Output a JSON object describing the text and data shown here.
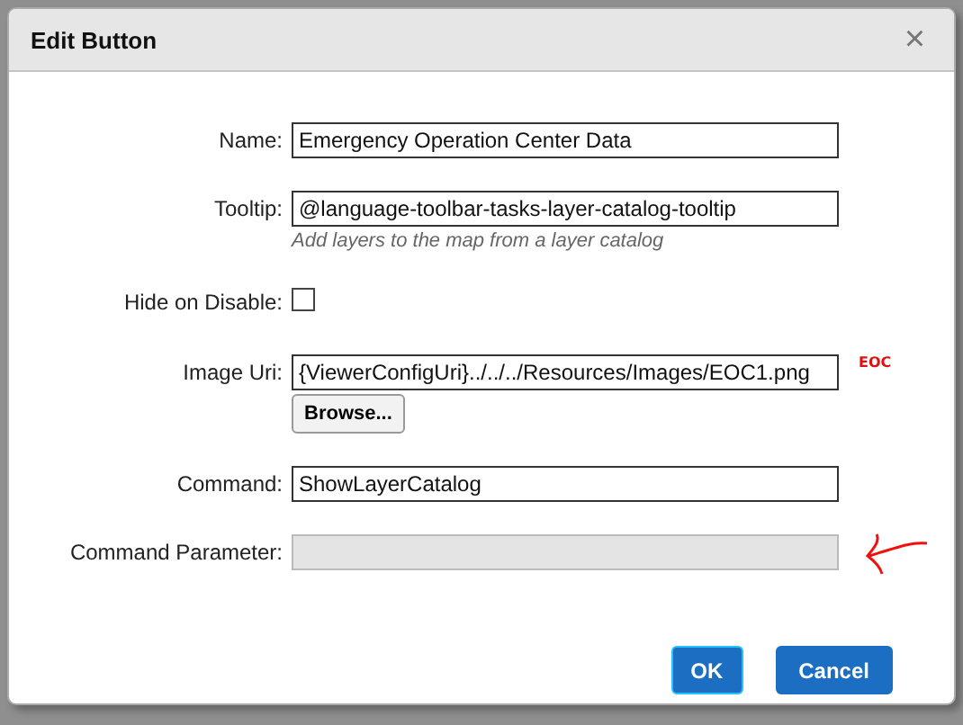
{
  "dialog": {
    "title": "Edit Button",
    "close": "×"
  },
  "fields": [
    {
      "kind": "text",
      "label": "Name:",
      "value": "Emergency Operation Center Data"
    },
    {
      "kind": "text",
      "label": "Tooltip:",
      "value": "@language-toolbar-tasks-layer-catalog-tooltip",
      "hint": "Add layers to the map from a layer catalog"
    },
    {
      "kind": "checkbox",
      "label": "Hide on Disable:",
      "checked": false
    },
    {
      "kind": "file",
      "label": "Image Uri:",
      "value": "{ViewerConfigUri}../../../Resources/Images/EOC1.png",
      "button": "Browse...",
      "note": "EOC"
    },
    {
      "kind": "text",
      "label": "Command:",
      "value": "ShowLayerCatalog"
    },
    {
      "kind": "text",
      "label": "Command Parameter:",
      "disabled": true,
      "arrow": true
    }
  ],
  "buttons": [
    {
      "label": "OK",
      "focused": true
    },
    {
      "label": "Cancel",
      "focused": false
    }
  ]
}
